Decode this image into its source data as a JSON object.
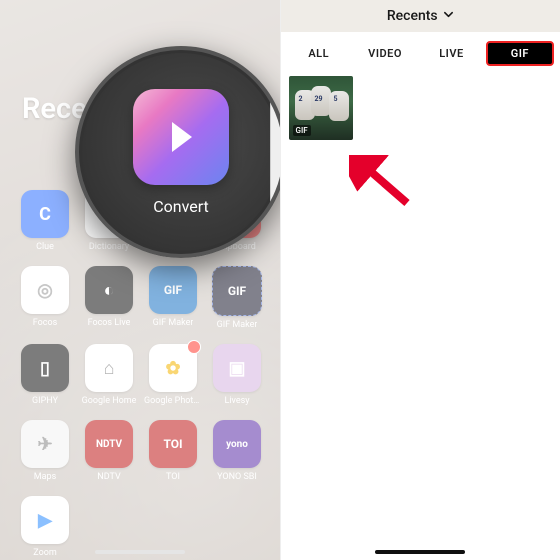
{
  "left": {
    "folder_title": "Recently",
    "zoom_app_label": "Convert",
    "apps": [
      {
        "label": "Clue",
        "icon": "C",
        "bg": "#2f6fff"
      },
      {
        "label": "Dictionary",
        "icon": "●",
        "bg": "#fff",
        "fg": "#c1272d"
      },
      {
        "label": "Dictionary",
        "icon": "📕",
        "bg": "#ffa53c"
      },
      {
        "label": "Flipboard",
        "icon": "F",
        "bg": "#e12828"
      },
      {
        "label": "Focos",
        "icon": "◎",
        "bg": "#fff",
        "fg": "#999"
      },
      {
        "label": "Focos Live",
        "icon": "◐",
        "bg": "#111"
      },
      {
        "label": "GIF Maker",
        "icon": "GIF",
        "bg": "#1b74c5"
      },
      {
        "label": "GIF Maker",
        "icon": "GIF",
        "bg": "#1a1a2e"
      },
      {
        "label": "GIPHY",
        "icon": "▯",
        "bg": "#111"
      },
      {
        "label": "Google Home",
        "icon": "⌂",
        "bg": "#fff",
        "fg": "#777"
      },
      {
        "label": "Google Photos",
        "icon": "✿",
        "bg": "#fff",
        "fg": "#f4b400",
        "badge": true
      },
      {
        "label": "Livesy",
        "icon": "▣",
        "bg": "#d6b4e0"
      },
      {
        "label": "Maps",
        "icon": "✈",
        "bg": "#f2f2f2",
        "fg": "#888"
      },
      {
        "label": "NDTV",
        "icon": "NDTV",
        "bg": "#c01818"
      },
      {
        "label": "TOI",
        "icon": "TOI",
        "bg": "#c01818"
      },
      {
        "label": "YONO SBI",
        "icon": "yono",
        "bg": "#5c2fa8"
      },
      {
        "label": "Zoom",
        "icon": "▶",
        "bg": "#fff",
        "fg": "#2D8CFF"
      }
    ]
  },
  "right": {
    "recents_label": "Recents",
    "tabs": {
      "all": "ALL",
      "video": "VIDEO",
      "live": "LIVE",
      "gif": "GIF"
    },
    "thumb_badge": "GIF"
  },
  "colors": {
    "arrow": "#e4002b",
    "gif_tab_border": "#ee2222"
  }
}
